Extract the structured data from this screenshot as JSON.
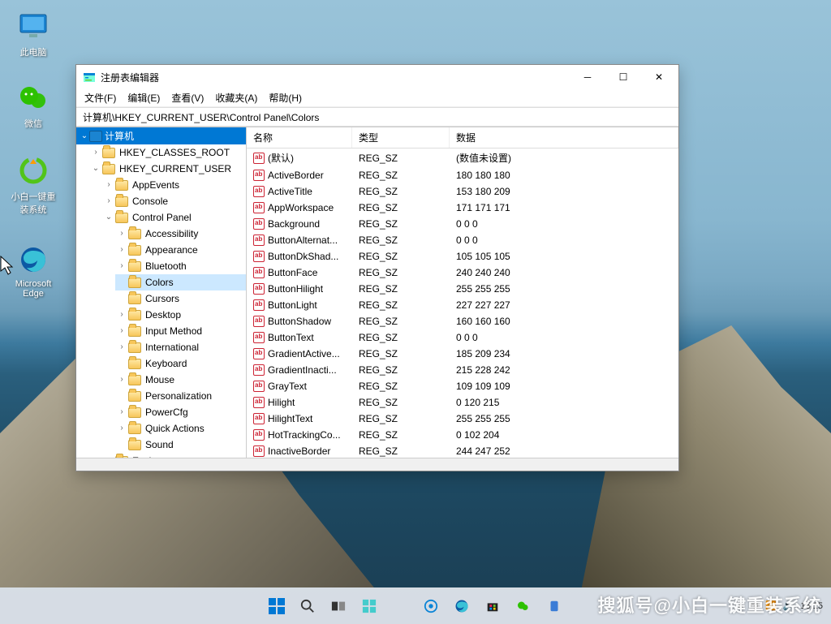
{
  "desktop": {
    "icons": [
      {
        "label": "此电脑"
      },
      {
        "label": "微信"
      },
      {
        "label": "小白一键重装系统"
      },
      {
        "label": "Microsoft Edge"
      }
    ]
  },
  "taskbar": {
    "time": "15:15",
    "watermark": "搜狐号@小白一键重装系统"
  },
  "window": {
    "title": "注册表编辑器",
    "menu": {
      "file": "文件(F)",
      "edit": "编辑(E)",
      "view": "查看(V)",
      "fav": "收藏夹(A)",
      "help": "帮助(H)"
    },
    "address": "计算机\\HKEY_CURRENT_USER\\Control Panel\\Colors",
    "tree": {
      "root": "计算机",
      "hkcr": "HKEY_CLASSES_ROOT",
      "hkcu": "HKEY_CURRENT_USER",
      "hkcu_children": [
        "AppEvents",
        "Console",
        "Control Panel"
      ],
      "cp_children": [
        "Accessibility",
        "Appearance",
        "Bluetooth",
        "Colors",
        "Cursors",
        "Desktop",
        "Input Method",
        "International",
        "Keyboard",
        "Mouse",
        "Personalization",
        "PowerCfg",
        "Quick Actions",
        "Sound"
      ],
      "env": "Environment"
    },
    "columns": {
      "name": "名称",
      "type": "类型",
      "data": "数据"
    },
    "values": [
      {
        "name": "(默认)",
        "type": "REG_SZ",
        "data": "(数值未设置)"
      },
      {
        "name": "ActiveBorder",
        "type": "REG_SZ",
        "data": "180 180 180"
      },
      {
        "name": "ActiveTitle",
        "type": "REG_SZ",
        "data": "153 180 209"
      },
      {
        "name": "AppWorkspace",
        "type": "REG_SZ",
        "data": "171 171 171"
      },
      {
        "name": "Background",
        "type": "REG_SZ",
        "data": "0 0 0"
      },
      {
        "name": "ButtonAlternat...",
        "type": "REG_SZ",
        "data": "0 0 0"
      },
      {
        "name": "ButtonDkShad...",
        "type": "REG_SZ",
        "data": "105 105 105"
      },
      {
        "name": "ButtonFace",
        "type": "REG_SZ",
        "data": "240 240 240"
      },
      {
        "name": "ButtonHilight",
        "type": "REG_SZ",
        "data": "255 255 255"
      },
      {
        "name": "ButtonLight",
        "type": "REG_SZ",
        "data": "227 227 227"
      },
      {
        "name": "ButtonShadow",
        "type": "REG_SZ",
        "data": "160 160 160"
      },
      {
        "name": "ButtonText",
        "type": "REG_SZ",
        "data": "0 0 0"
      },
      {
        "name": "GradientActive...",
        "type": "REG_SZ",
        "data": "185 209 234"
      },
      {
        "name": "GradientInacti...",
        "type": "REG_SZ",
        "data": "215 228 242"
      },
      {
        "name": "GrayText",
        "type": "REG_SZ",
        "data": "109 109 109"
      },
      {
        "name": "Hilight",
        "type": "REG_SZ",
        "data": "0 120 215"
      },
      {
        "name": "HilightText",
        "type": "REG_SZ",
        "data": "255 255 255"
      },
      {
        "name": "HotTrackingCo...",
        "type": "REG_SZ",
        "data": "0 102 204"
      },
      {
        "name": "InactiveBorder",
        "type": "REG_SZ",
        "data": "244 247 252"
      }
    ]
  }
}
